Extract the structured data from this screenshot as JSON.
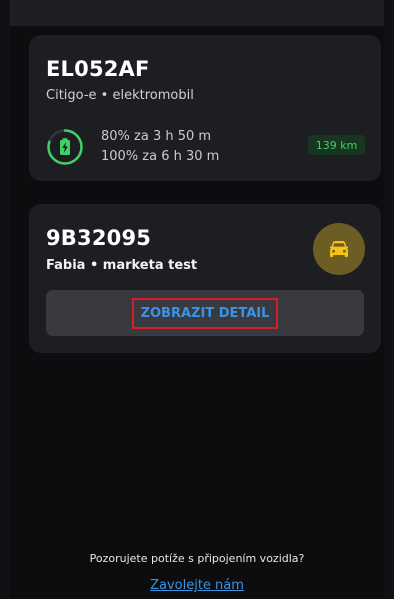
{
  "vehicles": [
    {
      "plate": "EL052AF",
      "subtitle": "Citigo-e • elektromobil",
      "charge_line1": "80% za 3 h 50 m",
      "charge_line2": "100% za 6 h 30 m",
      "range": "139 km",
      "battery_icon": "battery-charging-icon",
      "battery_level": 0.8
    },
    {
      "plate": "9B32095",
      "subtitle": "Fabia • marketa test",
      "icon": "car-icon",
      "detail_label": "ZOBRAZIT DETAIL"
    }
  ],
  "footer": {
    "question": "Pozorujete potíže s připojením vozidla?",
    "link": "Zavolejte nám"
  },
  "colors": {
    "background": "#0c0d0f",
    "card": "#1d1e22",
    "accent_blue": "#3a94e6",
    "charge_green": "#3fd06a",
    "car_badge": "#6b5d24",
    "car_icon": "#f3c316",
    "highlight_red": "#d81e25"
  }
}
